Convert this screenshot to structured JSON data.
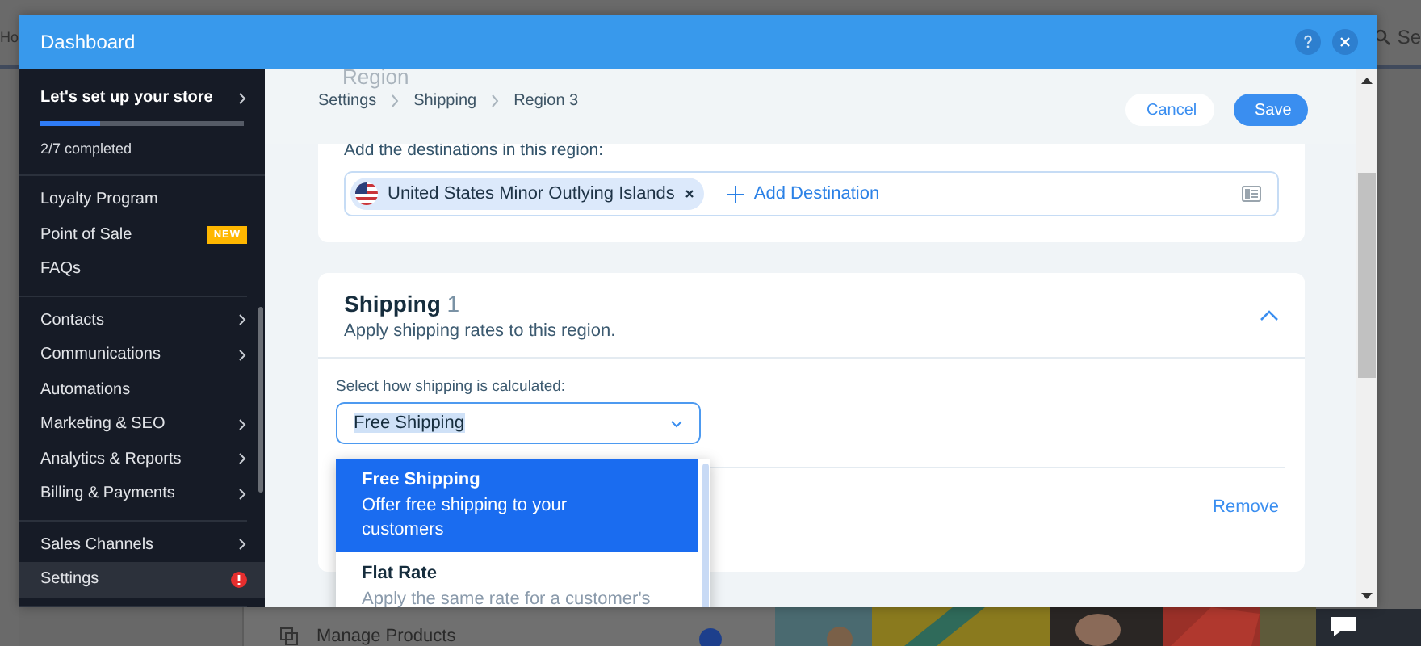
{
  "background_page": {
    "tab_text": "Ho",
    "search_text": "Se",
    "list_item": "Manage Products"
  },
  "dialog": {
    "title": "Dashboard"
  },
  "sidebar": {
    "setup": {
      "title": "Let's set up your store",
      "level": 0.29,
      "progress_text": "2/7 completed"
    },
    "sections": [
      {
        "items": [
          {
            "label": "Loyalty Program",
            "has_submenu": false,
            "alert": false,
            "selected": false
          },
          {
            "label": "Point of Sale",
            "badge": "NEW",
            "has_submenu": false,
            "alert": false,
            "selected": false
          },
          {
            "label": "FAQs",
            "has_submenu": false,
            "alert": false,
            "selected": false
          }
        ]
      },
      {
        "items": [
          {
            "label": "Contacts",
            "has_submenu": true,
            "alert": false,
            "selected": false
          },
          {
            "label": "Communications",
            "has_submenu": true,
            "alert": false,
            "selected": false
          },
          {
            "label": "Automations",
            "has_submenu": false,
            "alert": false,
            "selected": false
          },
          {
            "label": "Marketing & SEO",
            "has_submenu": true,
            "alert": false,
            "selected": false
          },
          {
            "label": "Analytics & Reports",
            "has_submenu": true,
            "alert": false,
            "selected": false
          },
          {
            "label": "Billing & Payments",
            "has_submenu": true,
            "alert": false,
            "selected": false
          }
        ]
      },
      {
        "items": [
          {
            "label": "Sales Channels",
            "has_submenu": true,
            "alert": false,
            "selected": false
          },
          {
            "label": "Settings",
            "has_submenu": false,
            "alert": true,
            "selected": true
          }
        ]
      }
    ]
  },
  "header": {
    "section_title": "Region",
    "breadcrumbs": [
      "Settings",
      "Shipping",
      "Region 3"
    ],
    "buttons": {
      "cancel": "Cancel",
      "save": "Save"
    }
  },
  "destinations": {
    "prompt": "Add the destinations in this region:",
    "tags": [
      "United States Minor Outlying Islands"
    ],
    "add_label": "Add Destination"
  },
  "shipping": {
    "title": "Shipping",
    "count": "1",
    "subtitle": "Apply shipping rates to this region.",
    "expanded": true,
    "method_label": "Select how shipping is calculated:",
    "value": "Free Shipping",
    "value_highlighted": true,
    "dropdown_expanded": true,
    "options": [
      {
        "title": "Free Shipping",
        "description": "Offer free shipping to your customers",
        "selected": true
      },
      {
        "title": "Flat Rate",
        "description": "Apply the same rate for a customer's",
        "selected": false
      }
    ],
    "remove_label": "Remove"
  }
}
